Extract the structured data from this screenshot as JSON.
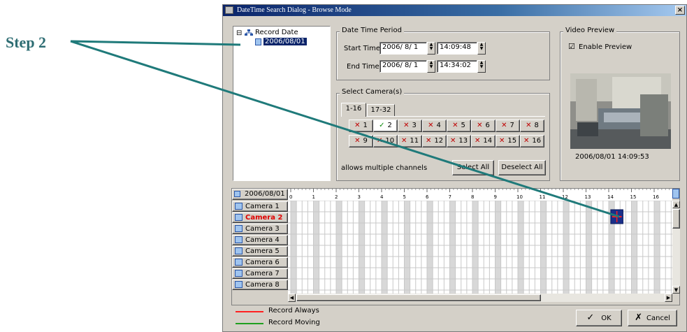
{
  "annotation": {
    "label": "Step 2",
    "color": "#2e6d73"
  },
  "window": {
    "title": "DateTime Search Dialog - Browse Mode",
    "close_glyph": "×"
  },
  "tree": {
    "root_label": "Record Date",
    "child_label": "2006/08/01",
    "expander": "⊟"
  },
  "date_time_period": {
    "group_title": "Date Time Period",
    "start_label": "Start Time:",
    "start_date": "2006/ 8/ 1",
    "start_time": "14:09:48",
    "end_label": "End Time:",
    "end_date": "2006/ 8/ 1",
    "end_time": "14:34:02"
  },
  "cameras": {
    "group_title": "Select Camera(s)",
    "tabs": [
      "1-16",
      "17-32"
    ],
    "buttons": [
      {
        "num": "1",
        "mark": "✕",
        "state": "off"
      },
      {
        "num": "2",
        "mark": "✓",
        "state": "on"
      },
      {
        "num": "3",
        "mark": "✕",
        "state": "off"
      },
      {
        "num": "4",
        "mark": "✕",
        "state": "off"
      },
      {
        "num": "5",
        "mark": "✕",
        "state": "off"
      },
      {
        "num": "6",
        "mark": "✕",
        "state": "off"
      },
      {
        "num": "7",
        "mark": "✕",
        "state": "off"
      },
      {
        "num": "8",
        "mark": "✕",
        "state": "off"
      },
      {
        "num": "9",
        "mark": "✕",
        "state": "off"
      },
      {
        "num": "10",
        "mark": "✕",
        "state": "off"
      },
      {
        "num": "11",
        "mark": "✕",
        "state": "off"
      },
      {
        "num": "12",
        "mark": "✕",
        "state": "off"
      },
      {
        "num": "13",
        "mark": "✕",
        "state": "off"
      },
      {
        "num": "14",
        "mark": "✕",
        "state": "off"
      },
      {
        "num": "15",
        "mark": "✕",
        "state": "off"
      },
      {
        "num": "16",
        "mark": "✕",
        "state": "off"
      }
    ],
    "note": "allows multiple channels",
    "select_all": "Select All",
    "deselect_all": "Deselect All"
  },
  "video_preview": {
    "group_title": "Video Preview",
    "enable_label": "Enable Preview",
    "checked_glyph": "☑",
    "timestamp": "2006/08/01 14:09:53"
  },
  "timeline": {
    "date": "2006/08/01",
    "hours": [
      "0",
      "1",
      "2",
      "3",
      "4",
      "5",
      "6",
      "7",
      "8",
      "9",
      "10",
      "11",
      "12",
      "13",
      "14",
      "15",
      "16"
    ],
    "camera_rows": [
      {
        "label": "Camera 1",
        "active": false
      },
      {
        "label": "Camera 2",
        "active": true
      },
      {
        "label": "Camera 3",
        "active": false
      },
      {
        "label": "Camera 4",
        "active": false
      },
      {
        "label": "Camera 5",
        "active": false
      },
      {
        "label": "Camera 6",
        "active": false
      },
      {
        "label": "Camera 7",
        "active": false
      },
      {
        "label": "Camera 8",
        "active": false
      }
    ]
  },
  "legend": {
    "always_label": "Record Always",
    "always_color": "#ff2020",
    "moving_label": "Record Moving",
    "moving_color": "#20a020"
  },
  "footer": {
    "ok_label": "OK",
    "ok_glyph": "✓",
    "cancel_label": "Cancel",
    "cancel_glyph": "✗"
  }
}
